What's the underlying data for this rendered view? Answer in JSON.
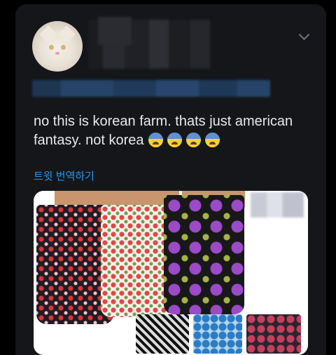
{
  "tweet": {
    "text": "no this is korean farm. thats just american fantasy. not korea",
    "emoji_count": 4,
    "emoji_name": "anxious-face-with-sweat",
    "translate_label": "트윗 번역하기"
  },
  "colors": {
    "background": "#000000",
    "card": "#15161a",
    "text": "#e7e9ea",
    "link": "#1d9bf0"
  },
  "icons": {
    "menu": "chevron-down-icon",
    "avatar": "white-cat-avatar"
  }
}
